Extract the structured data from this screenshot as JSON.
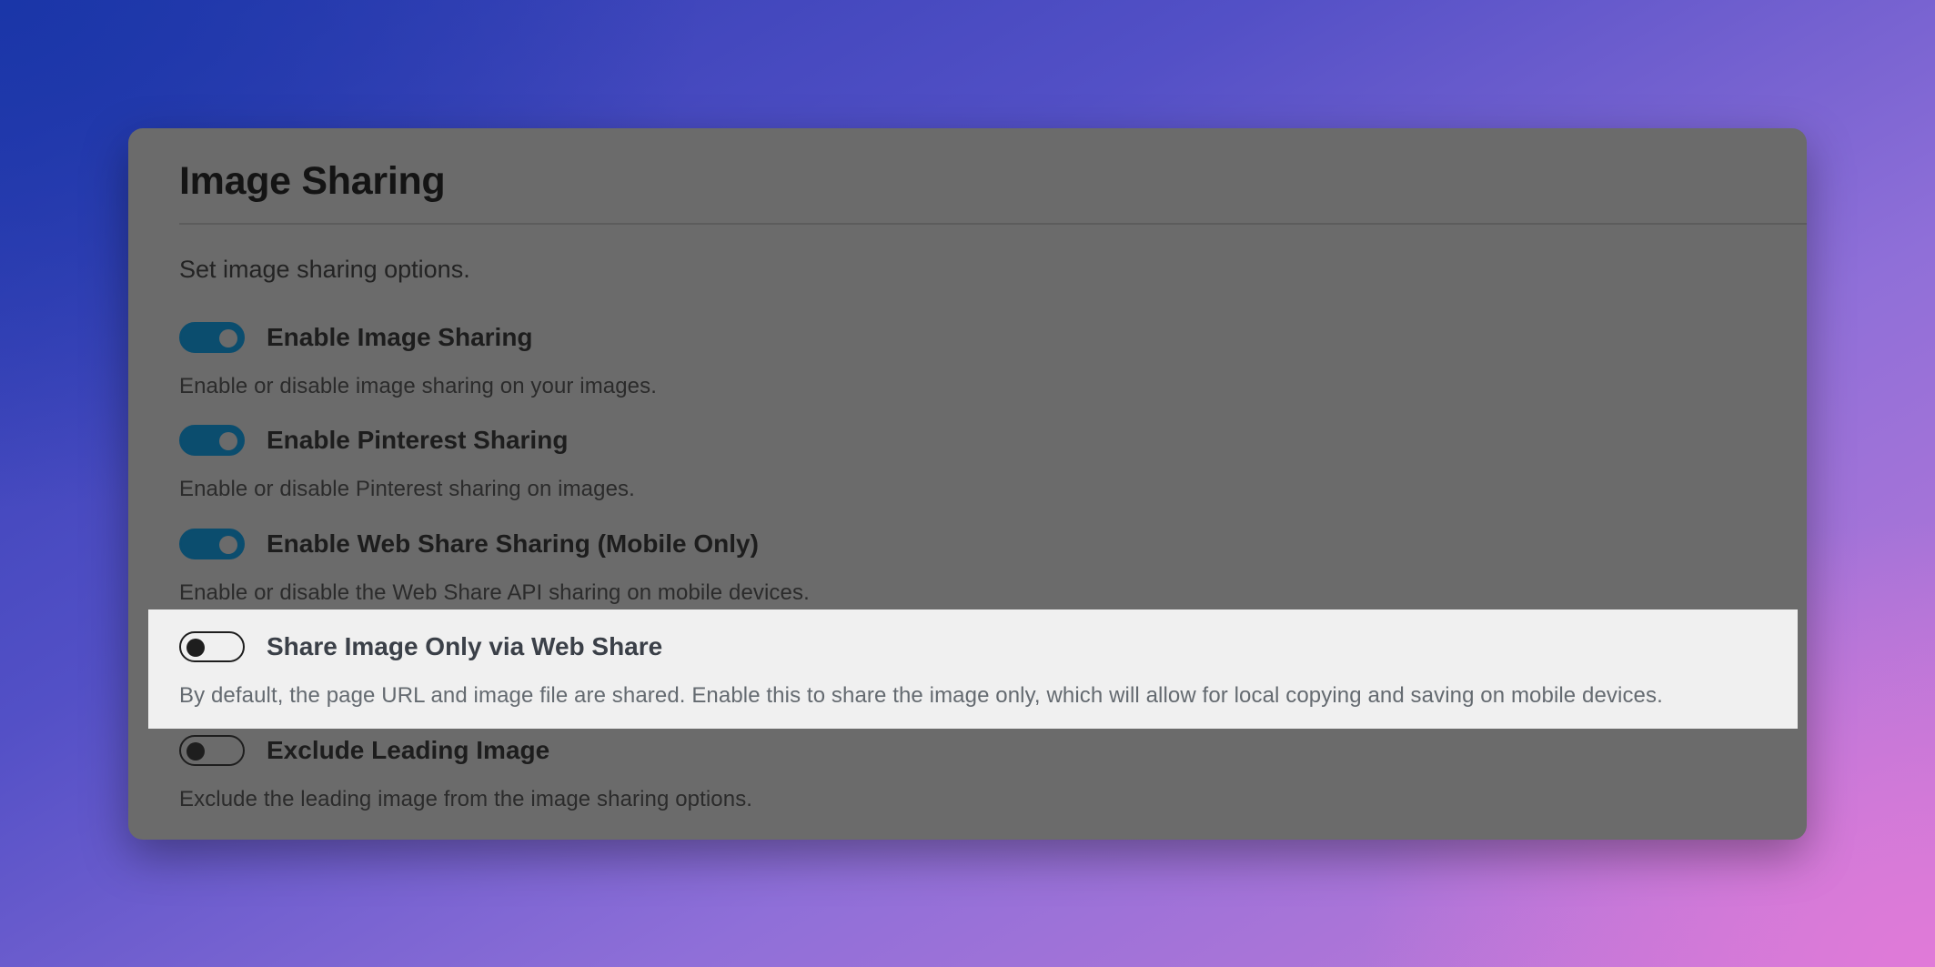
{
  "panel": {
    "title": "Image Sharing",
    "subtitle": "Set image sharing options."
  },
  "settings": [
    {
      "label": "Enable Image Sharing",
      "description": "Enable or disable image sharing on your images.",
      "enabled": true
    },
    {
      "label": "Enable Pinterest Sharing",
      "description": "Enable or disable Pinterest sharing on images.",
      "enabled": true
    },
    {
      "label": "Enable Web Share Sharing (Mobile Only)",
      "description": "Enable or disable the Web Share API sharing on mobile devices.",
      "enabled": true
    },
    {
      "label": "Share Image Only via Web Share",
      "description": "By default, the page URL and image file are shared. Enable this to share the image only, which will allow for local copying and saving on mobile devices.",
      "enabled": false,
      "highlighted": true
    },
    {
      "label": "Exclude Leading Image",
      "description": "Exclude the leading image from the image sharing options.",
      "enabled": false
    }
  ],
  "colors": {
    "toggle_on": "#0b4d6e",
    "panel_bg": "#6b6b6b",
    "highlight_bg": "#f0f0f0"
  }
}
